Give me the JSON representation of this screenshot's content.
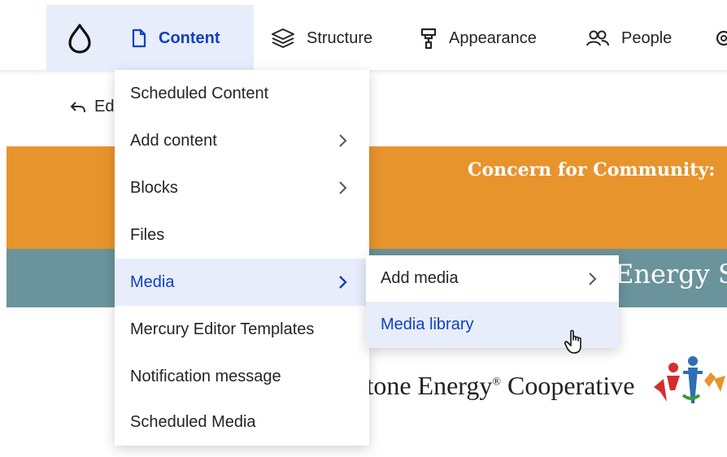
{
  "toolbar": {
    "logo_icon": "drupal-drop-icon",
    "items": [
      {
        "label": "Content",
        "icon": "file-icon",
        "active": true
      },
      {
        "label": "Structure",
        "icon": "layers-icon"
      },
      {
        "label": "Appearance",
        "icon": "paint-roller-icon"
      },
      {
        "label": "People",
        "icon": "people-icon"
      }
    ],
    "accent_color": "#0f3fc4",
    "active_background": "#e8edfb"
  },
  "page": {
    "back_link": "Ed",
    "banner_text": "Concern for Community:",
    "banner_color": "#e8942d",
    "subbanner_text": "Energy S",
    "subbanner_color": "#6b939c",
    "coop_name": "stone Energy",
    "coop_suffix": "Cooperative",
    "registered_mark": "®"
  },
  "content_menu": {
    "items": [
      {
        "label": "Scheduled Content"
      },
      {
        "label": "Add content",
        "has_submenu": true
      },
      {
        "label": "Blocks",
        "has_submenu": true
      },
      {
        "label": "Files"
      },
      {
        "label": "Media",
        "has_submenu": true,
        "active": true
      },
      {
        "label": "Mercury Editor Templates"
      },
      {
        "label": "Notification message"
      },
      {
        "label": "Scheduled Media"
      }
    ]
  },
  "media_submenu": {
    "items": [
      {
        "label": "Add media",
        "has_submenu": true
      },
      {
        "label": "Media library",
        "hovered": true
      }
    ]
  }
}
